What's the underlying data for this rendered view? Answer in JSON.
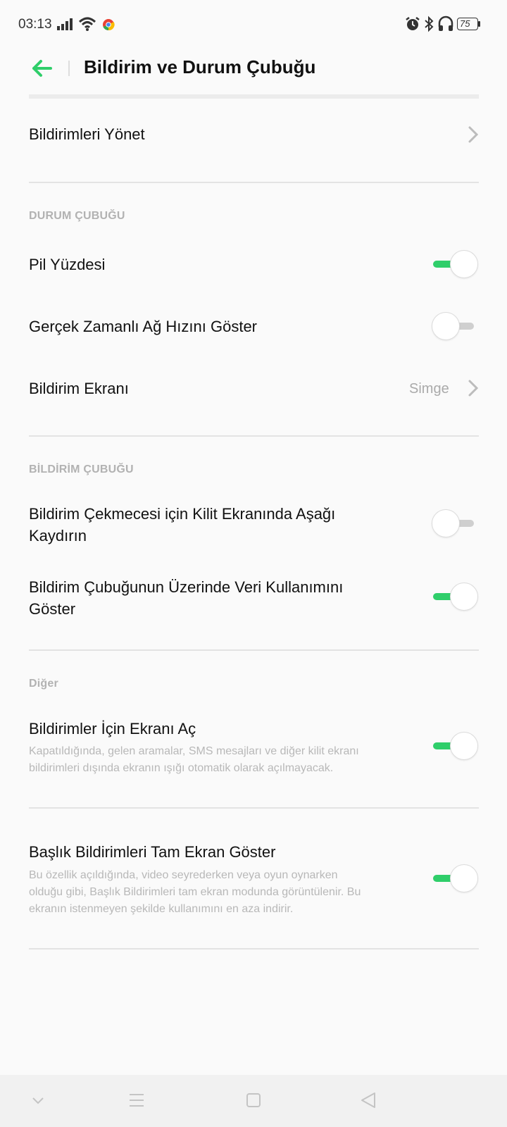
{
  "status_bar": {
    "time": "03:13",
    "battery": "75"
  },
  "header": {
    "title": "Bildirim ve Durum Çubuğu"
  },
  "rows": {
    "manage": {
      "label": "Bildirimleri Yönet"
    },
    "battery_pct": {
      "label": "Pil Yüzdesi",
      "on": true
    },
    "net_speed": {
      "label": "Gerçek Zamanlı Ağ Hızını Göster",
      "on": false
    },
    "notif_display": {
      "label": "Bildirim Ekranı",
      "value": "Simge"
    },
    "lock_swipe": {
      "label_line1": "Bildirim Çekmecesi için Kilit Ekranında Aşağı",
      "label_line2": "Kaydırın",
      "on": false
    },
    "data_usage": {
      "label_line1": "Bildirim Çubuğunun Üzerinde Veri Kullanımını",
      "label_line2": "Göster",
      "on": true
    },
    "wake_screen": {
      "label": "Bildirimler İçin Ekranı Aç",
      "desc_line1": "Kapatıldığında, gelen aramalar, SMS mesajları ve diğer kilit ekranı",
      "desc_line2": "bildirimleri dışında ekranın ışığı otomatik olarak açılmayacak.",
      "on": true
    },
    "heads_up": {
      "label": "Başlık Bildirimleri Tam Ekran Göster",
      "desc_line1": "Bu özellik açıldığında, video seyrederken veya oyun oynarken",
      "desc_line2": "olduğu gibi, Başlık Bildirimleri tam ekran modunda görüntülenir. Bu",
      "desc_line3": "ekranın istenmeyen şekilde kullanımını en aza indirir.",
      "on": true
    }
  },
  "sections": {
    "status_bar": "DURUM ÇUBUĞU",
    "notification_bar": "BİLDİRİM ÇUBUĞU",
    "other": "Diğer"
  },
  "colors": {
    "accent": "#2fce6a",
    "toggle_off": "#cfcfcf"
  },
  "icons": {
    "status": [
      "signal-icon",
      "wifi-icon",
      "chrome-icon",
      "alarm-icon",
      "bluetooth-icon",
      "headphones-icon",
      "battery-icon"
    ],
    "nav": [
      "chevron-down-icon",
      "menu-icon",
      "home-square-icon",
      "back-triangle-icon"
    ]
  }
}
